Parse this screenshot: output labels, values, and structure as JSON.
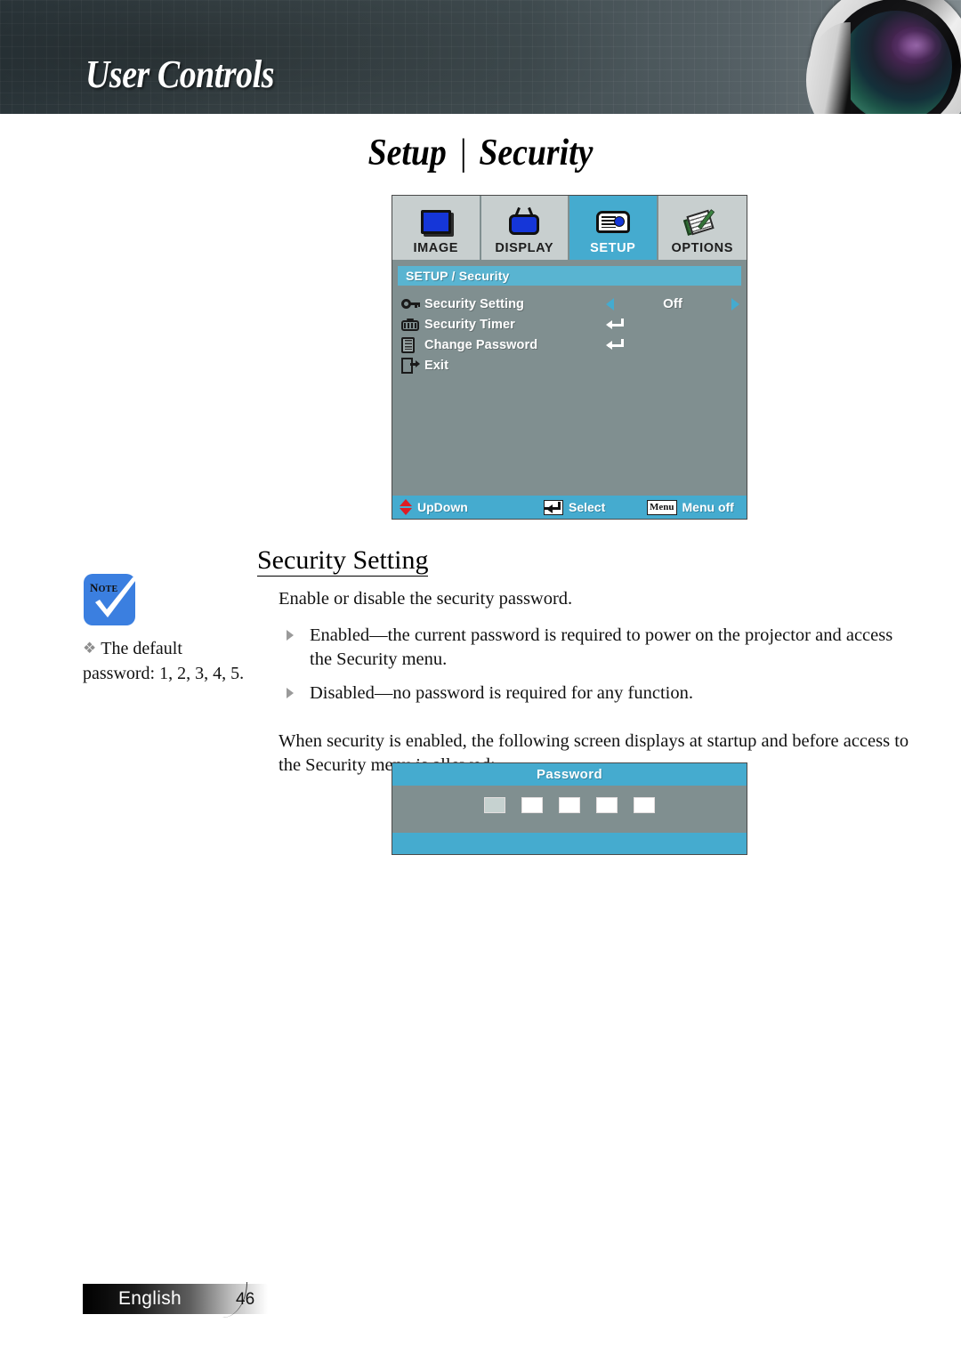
{
  "banner": {
    "title": "User Controls",
    "lens_icon": "projector-lens-graphic"
  },
  "page_title": {
    "left": "Setup",
    "separator": "|",
    "right": "Security"
  },
  "osd": {
    "tabs": [
      {
        "label": "IMAGE",
        "icon": "image-monitor-icon",
        "active": false
      },
      {
        "label": "DISPLAY",
        "icon": "display-tv-icon",
        "active": false
      },
      {
        "label": "SETUP",
        "icon": "setup-projector-icon",
        "active": true
      },
      {
        "label": "OPTIONS",
        "icon": "options-notes-icon",
        "active": false
      }
    ],
    "breadcrumb": "SETUP / Security",
    "rows": [
      {
        "label": "Security Setting",
        "icon": "key-icon",
        "control": "value",
        "value": "Off"
      },
      {
        "label": "Security Timer",
        "icon": "timer-icon",
        "control": "enter",
        "value": ""
      },
      {
        "label": "Change Password",
        "icon": "password-icon",
        "control": "enter",
        "value": ""
      },
      {
        "label": "Exit",
        "icon": "exit-door-icon",
        "control": "none",
        "value": ""
      }
    ],
    "footer": [
      {
        "label": "UpDown",
        "key": "updown-arrows-icon",
        "key_text": ""
      },
      {
        "label": "Select",
        "key": "enter-key-icon",
        "key_text": ""
      },
      {
        "label": "Menu off",
        "key": "menu-key-icon",
        "key_text": "Menu"
      }
    ],
    "colors": {
      "accent": "#45abcf",
      "body": "#808f90",
      "tab_inactive": "#c8cfcf",
      "crumb": "#59b4d1",
      "arrow_red": "#e01b24"
    }
  },
  "section": {
    "heading": "Security Setting",
    "intro": "Enable or disable the security password.",
    "bullets": [
      "Enabled—the current password is required to power on the projector and access the Security menu.",
      "Disabled—no password is required for any function."
    ],
    "closing": "When security is enabled, the following screen displays at startup and before access to the Security menu is allowed:"
  },
  "note": {
    "badge_label": "Note",
    "badge_icon": "note-checkmark-icon",
    "bullet_glyph": "❖",
    "text": "The default password: 1, 2, 3, 4, 5."
  },
  "password_dialog": {
    "title": "Password",
    "boxes": [
      {
        "state": "active"
      },
      {
        "state": "empty"
      },
      {
        "state": "empty"
      },
      {
        "state": "empty"
      },
      {
        "state": "empty"
      }
    ]
  },
  "footer": {
    "language": "English",
    "page_number": "46"
  }
}
